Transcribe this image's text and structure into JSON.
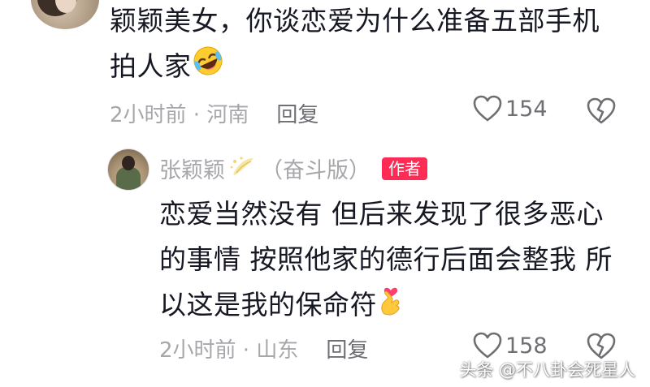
{
  "comment": {
    "lines": [
      "颖颖美女，你谈恋爱为什么准备五部手机",
      "拍人家"
    ],
    "emoji": "rolling-on-floor-laughing-emoji",
    "time": "2小时前 · 河南",
    "reply_label": "回复",
    "like_count": "154"
  },
  "reply": {
    "author_name": "张颖颖",
    "author_suffix": "（奋斗版）",
    "author_tag": "作者",
    "lines": [
      "恋爱当然没有 但后来发现了很多恶心",
      "的事情 按照他家的德行后面会整我 所",
      "以这是我的保命符"
    ],
    "emoji": "finger-heart-emoji",
    "time": "2小时前 · 山东",
    "reply_label": "回复",
    "like_count": "158"
  },
  "watermark": "头条 @不八卦会死星人",
  "colors": {
    "primary_text": "#161823",
    "secondary_text": "#a7a7ab",
    "icon": "#6e6e73",
    "author_tag_bg": "#fe2c55"
  }
}
